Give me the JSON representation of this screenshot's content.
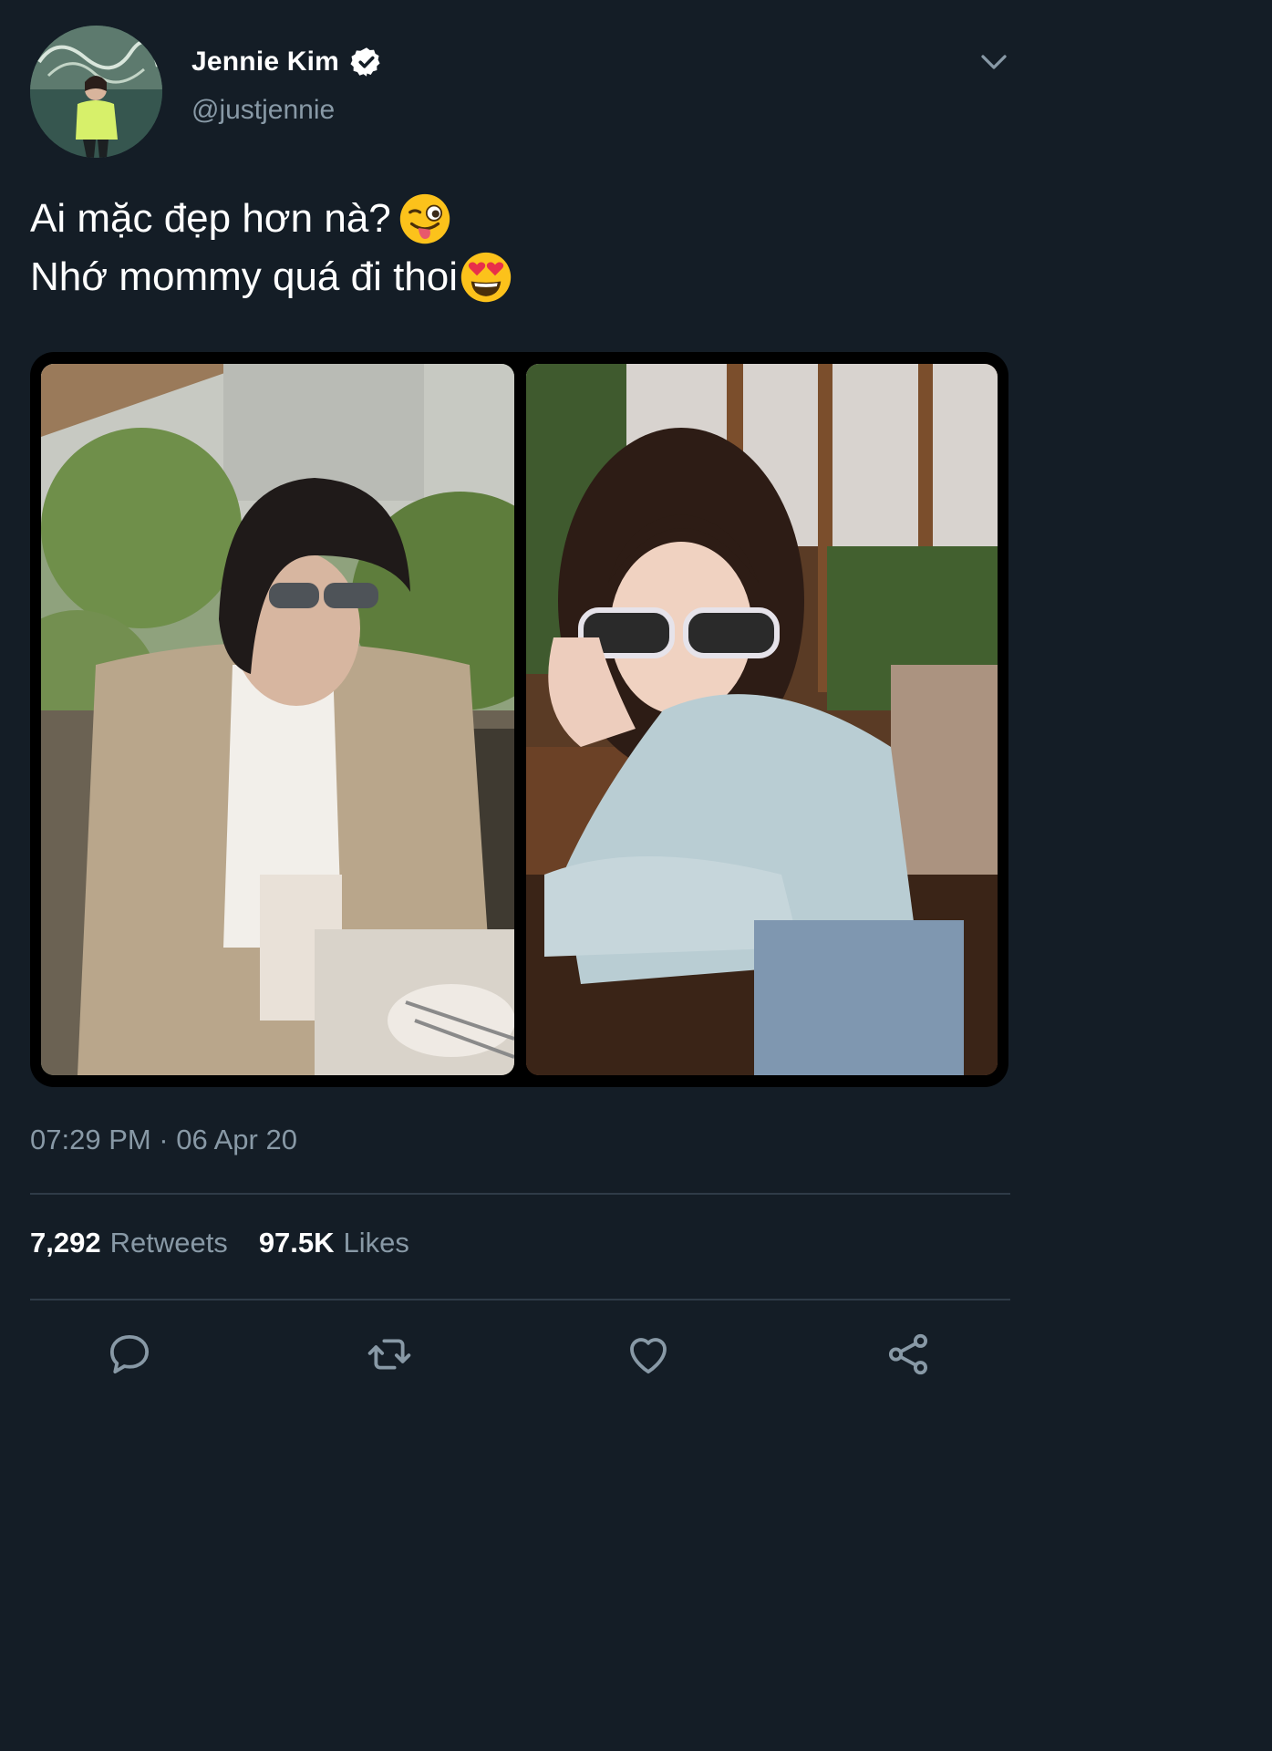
{
  "tweet": {
    "author": {
      "display_name": "Jennie Kim",
      "handle": "@justjennie",
      "verified": true
    },
    "text_line1": "Ai mặc đẹp hơn nà?",
    "text_line2": "Nhớ mommy quá đi thoi",
    "emoji_line1": "winking-face-with-tongue",
    "emoji_line2": "smiling-face-with-heart-eyes",
    "timestamp": "07:29 PM · 06 Apr 20",
    "stats": {
      "retweets_count": "7,292",
      "retweets_label": "Retweets",
      "likes_count": "97.5K",
      "likes_label": "Likes"
    },
    "actions": [
      "reply-icon",
      "retweet-icon",
      "like-icon",
      "share-icon"
    ]
  },
  "theme": {
    "background": "#141d26",
    "text": "#ffffff",
    "secondary_text": "#8899a6",
    "divider": "#2f3b47"
  }
}
